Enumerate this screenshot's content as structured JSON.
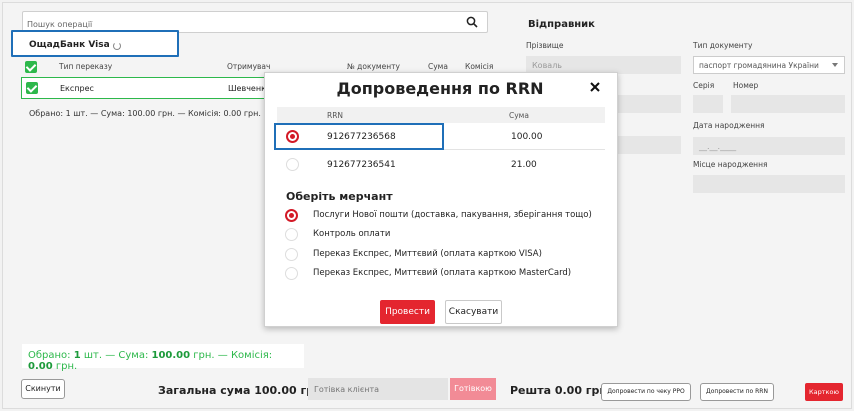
{
  "search": {
    "placeholder": "Пошук операції"
  },
  "bank_tab": {
    "label": "ОщадБанк Visa"
  },
  "table": {
    "headers": {
      "type": "Тип переказу",
      "recipient": "Отримувач",
      "doc": "№ документу",
      "amount": "Сума",
      "fee": "Комісія"
    },
    "row": {
      "type": "Експрес",
      "recipient": "Шевченко"
    }
  },
  "summary_small": "Обрано: 1 шт. — Сума: 100.00 грн. — Комісія: 0.00 грн.",
  "summary_big": {
    "p1": "Обрано: ",
    "count": "1",
    "p2": " шт. — Сума: ",
    "sum": "100.00",
    "p3": " грн. — Комісія: ",
    "fee": "0.00",
    "p4": " грн."
  },
  "bottom": {
    "reset": "Скинути",
    "total": "Загальна сума 100.00 грн.",
    "cash_placeholder": "Готівка клієнта",
    "cash_btn": "Готівкою",
    "change": "Решта 0.00 грн",
    "btn_rro": "Допровести по чеку РРО",
    "btn_rrn": "Допровести по RRN",
    "btn_card": "Карткою"
  },
  "sender": {
    "title": "Відправник",
    "surname_label": "Прізвище",
    "surname_placeholder": "Коваль",
    "doc_type_label": "Тип документу",
    "doc_type_value": "паспорт громадянина України",
    "series_label": "Серія",
    "number_label": "Номер",
    "birth_label": "Дата народження",
    "birth_placeholder": "__.__.____",
    "birthplace_label": "Місце народження"
  },
  "modal": {
    "title": "Допроведення по RRN",
    "col_rrn": "RRN",
    "col_sum": "Сума",
    "rows": [
      {
        "rrn": "912677236568",
        "sum": "100.00",
        "selected": true
      },
      {
        "rrn": "912677236541",
        "sum": "21.00",
        "selected": false
      }
    ],
    "merchant_title": "Оберіть мерчант",
    "merchants": [
      "Послуги Нової пошти (доставка, пакування, зберігання тощо)",
      "Контроль оплати",
      "Переказ Експрес, Миттєвий (оплата карткою VISA)",
      "Переказ Експрес, Миттєвий (оплата карткою MasterCard)"
    ],
    "confirm": "Провести",
    "cancel": "Скасувати"
  },
  "colors": {
    "accent": "#e4262f",
    "success": "#2db84b",
    "highlight": "#1f6fb8"
  }
}
